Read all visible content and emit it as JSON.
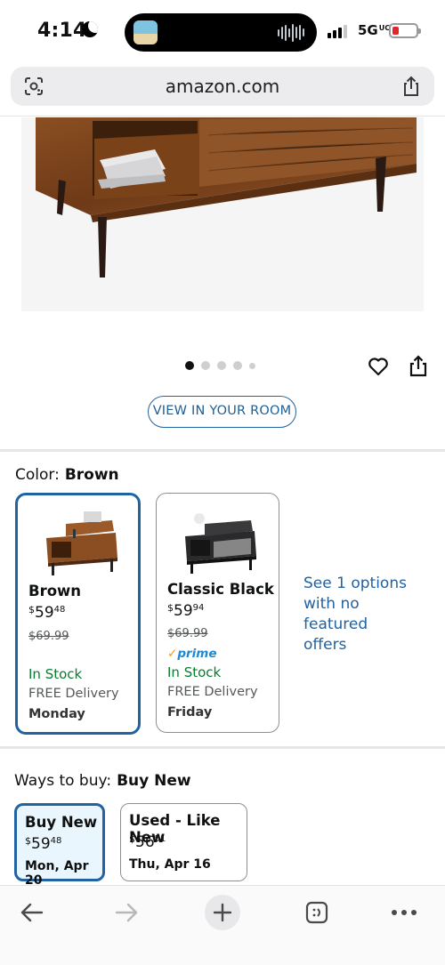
{
  "status_bar": {
    "time": "4:14",
    "network": "5G",
    "network_suffix": "UC"
  },
  "browser": {
    "url": "amazon.com"
  },
  "product": {
    "carousel_total": 5,
    "carousel_active": 1,
    "view_in_room_label": "VIEW IN YOUR ROOM"
  },
  "color": {
    "label": "Color:",
    "selected": "Brown",
    "options": [
      {
        "name": "Brown",
        "price_currency": "$",
        "price_whole": "59",
        "price_fraction": "48",
        "list_price": "$69.99",
        "stock": "In Stock",
        "delivery": "FREE Delivery",
        "delivery_day": "Monday"
      },
      {
        "name": "Classic Black",
        "price_currency": "$",
        "price_whole": "59",
        "price_fraction": "94",
        "list_price": "$69.99",
        "prime": "prime",
        "stock": "In Stock",
        "delivery": "FREE Delivery",
        "delivery_day": "Friday"
      }
    ],
    "see_more": "See 1 options with no featured offers"
  },
  "ways_to_buy": {
    "label": "Ways to buy:",
    "selected": "Buy New",
    "options": [
      {
        "title": "Buy New",
        "price_currency": "$",
        "price_whole": "59",
        "price_fraction": "48",
        "date": "Mon, Apr 20"
      },
      {
        "title": "Used - Like New",
        "price_currency": "$",
        "price_whole": "56",
        "price_fraction": "51",
        "date": "Thu, Apr 16"
      }
    ]
  },
  "colors": {
    "accent": "#2162a1",
    "in_stock": "#067d2e",
    "prime_blue": "#1f8ad2",
    "prime_check": "#ff9900",
    "battery_low": "#e0262b"
  },
  "icons": [
    "lens-icon",
    "share-icon",
    "heart-icon",
    "back-icon",
    "forward-icon",
    "new-tab-icon",
    "tabs-icon",
    "more-icon"
  ]
}
